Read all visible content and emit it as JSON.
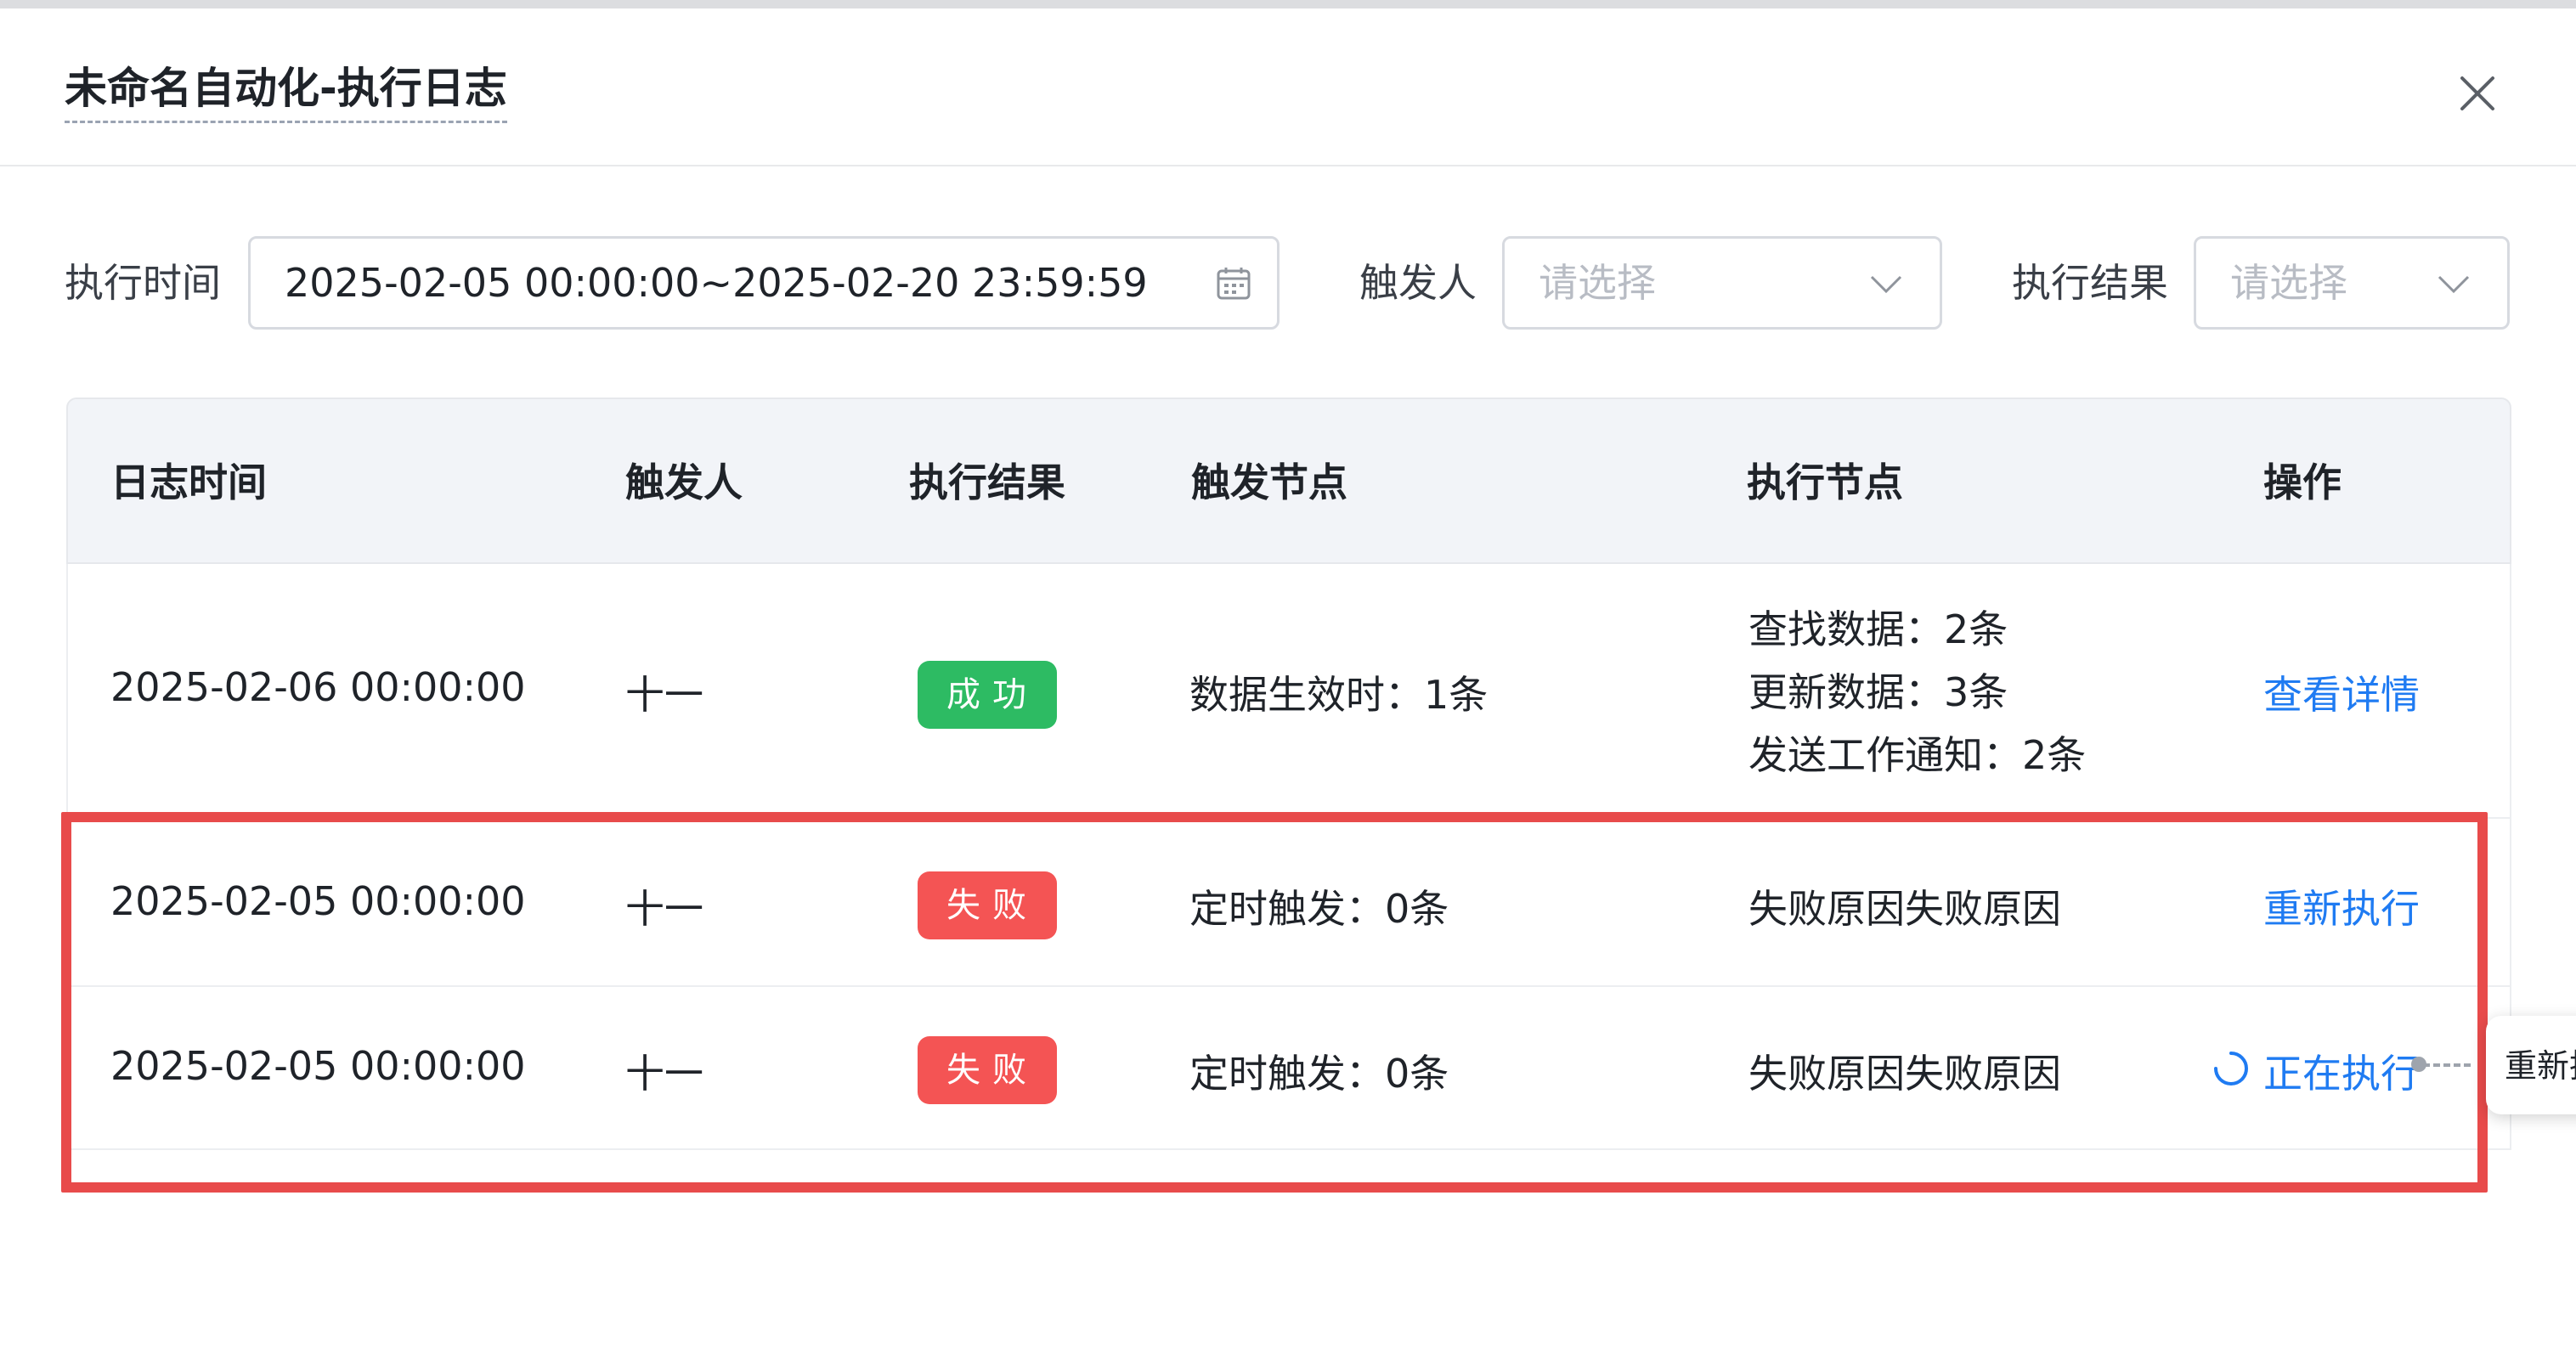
{
  "dialog": {
    "title": "未命名自动化-执行日志"
  },
  "filters": {
    "exec_time_label": "执行时间",
    "exec_time_value": "2025-02-05 00:00:00~2025-02-20 23:59:59",
    "trigger_person_label": "触发人",
    "trigger_person_placeholder": "请选择",
    "exec_result_label": "执行结果",
    "exec_result_placeholder": "请选择"
  },
  "table": {
    "columns": [
      "日志时间",
      "触发人",
      "执行结果",
      "触发节点",
      "执行节点",
      "操作"
    ],
    "rows": [
      {
        "log_time": "2025-02-06 00:00:00",
        "trigger_person": "十一",
        "result": "成功",
        "trigger_node": "数据生效时：1条",
        "exec_node_lines": [
          "查找数据：2条",
          "更新数据：3条",
          "发送工作通知：2条"
        ],
        "action": "查看详情"
      },
      {
        "log_time": "2025-02-05 00:00:00",
        "trigger_person": "十一",
        "result": "失败",
        "trigger_node": "定时触发：0条",
        "exec_node": "失败原因失败原因",
        "action": "重新执行"
      },
      {
        "log_time": "2025-02-05 00:00:00",
        "trigger_person": "十一",
        "result": "失败",
        "trigger_node": "定时触发：0条",
        "exec_node": "失败原因失败原因",
        "action": "正在执行"
      }
    ]
  },
  "tooltip": {
    "text": "重新执"
  },
  "colors": {
    "success": "#2dbb63",
    "fail": "#f45454",
    "link": "#1f7bf2",
    "highlight_border": "#e84b4b",
    "header_bg": "#f2f4f8"
  },
  "icons": {
    "close": "close-icon",
    "calendar": "calendar-icon",
    "chevron": "chevron-down-icon",
    "spinner": "loading-spinner-icon"
  }
}
